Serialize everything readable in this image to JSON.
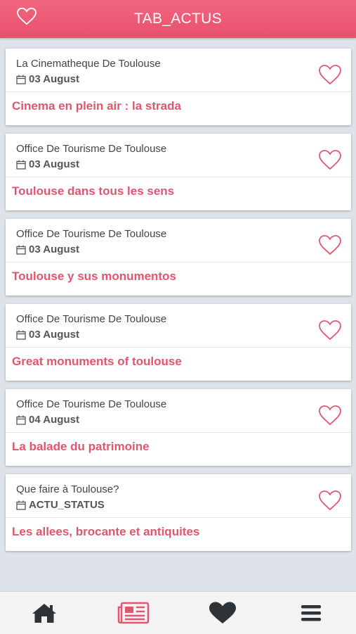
{
  "header": {
    "title": "TAB_ACTUS"
  },
  "items": [
    {
      "source": "La Cinematheque De Toulouse",
      "date": "03 August",
      "title": "Cinema en plein air : la strada"
    },
    {
      "source": "Office De Tourisme De Toulouse",
      "date": "03 August",
      "title": "Toulouse dans tous les sens"
    },
    {
      "source": "Office De Tourisme De Toulouse",
      "date": "03 August",
      "title": "Toulouse y sus monumentos"
    },
    {
      "source": "Office De Tourisme De Toulouse",
      "date": "03 August",
      "title": "Great monuments of toulouse"
    },
    {
      "source": "Office De Tourisme De Toulouse",
      "date": "04 August",
      "title": "La balade du patrimoine"
    },
    {
      "source": "Que faire à Toulouse?",
      "date": "ACTU_STATUS",
      "title": "Les allees, brocante et antiquites"
    }
  ],
  "tabs": [
    {
      "icon": "home-icon"
    },
    {
      "icon": "newspaper-icon",
      "active": true
    },
    {
      "icon": "heart-icon"
    },
    {
      "icon": "menu-icon"
    }
  ],
  "colors": {
    "accent": "#e8506d",
    "title_text": "#e0566e",
    "background": "#dde3e8",
    "tab_icon": "#2e3338"
  }
}
